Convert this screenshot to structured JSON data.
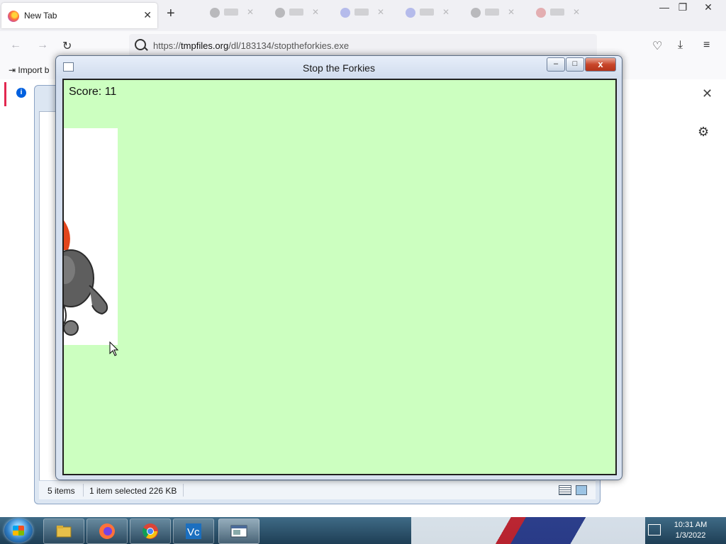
{
  "browser": {
    "tab": {
      "title": "New Tab",
      "close_label": "✕"
    },
    "new_tab_label": "+",
    "window_controls": {
      "minimize": "—",
      "restore": "❐",
      "close": "✕"
    },
    "url": {
      "prefix": "https://",
      "domain": "tmpfiles.org",
      "path": "/dl/183134/stoptheforkies.exe"
    },
    "bookmark_import": "Import b",
    "notification_close": "✕"
  },
  "explorer": {
    "status_items": "5 items",
    "status_selected": "1 item selected  226 KB"
  },
  "game": {
    "title": "Stop the Forkies",
    "score": "Score: 11",
    "canvas_color": "#ccffc0",
    "caption": {
      "minimize": "–",
      "maximize": "□",
      "close": "x"
    }
  },
  "taskbar": {
    "apps": [
      "file-explorer",
      "firefox",
      "chrome",
      "vscode",
      "game-window"
    ],
    "clock": {
      "time": "10:31 AM",
      "date": "1/3/2022"
    }
  }
}
